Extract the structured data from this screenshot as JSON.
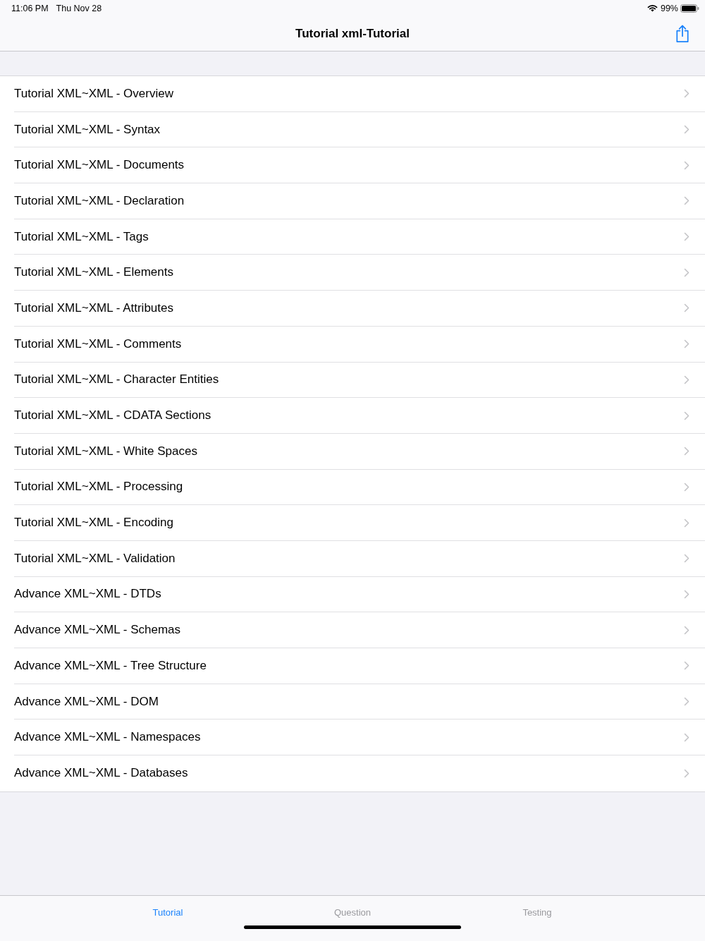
{
  "status_bar": {
    "time": "11:06 PM",
    "date": "Thu Nov 28",
    "battery": "99%"
  },
  "nav_bar": {
    "title": "Tutorial xml-Tutorial"
  },
  "list": {
    "items": [
      {
        "label": "Tutorial XML~XML - Overview"
      },
      {
        "label": "Tutorial XML~XML - Syntax"
      },
      {
        "label": "Tutorial XML~XML - Documents"
      },
      {
        "label": "Tutorial XML~XML - Declaration"
      },
      {
        "label": "Tutorial XML~XML - Tags"
      },
      {
        "label": "Tutorial XML~XML - Elements"
      },
      {
        "label": "Tutorial XML~XML - Attributes"
      },
      {
        "label": "Tutorial XML~XML - Comments"
      },
      {
        "label": "Tutorial XML~XML - Character Entities"
      },
      {
        "label": "Tutorial XML~XML - CDATA Sections"
      },
      {
        "label": "Tutorial XML~XML - White Spaces"
      },
      {
        "label": "Tutorial XML~XML - Processing"
      },
      {
        "label": "Tutorial XML~XML - Encoding"
      },
      {
        "label": "Tutorial XML~XML - Validation"
      },
      {
        "label": "Advance XML~XML - DTDs"
      },
      {
        "label": "Advance XML~XML - Schemas"
      },
      {
        "label": "Advance XML~XML - Tree Structure"
      },
      {
        "label": "Advance XML~XML - DOM"
      },
      {
        "label": "Advance XML~XML - Namespaces"
      },
      {
        "label": "Advance XML~XML - Databases"
      }
    ]
  },
  "tab_bar": {
    "tabs": [
      {
        "label": "Tutorial",
        "selected": true
      },
      {
        "label": "Question",
        "selected": false
      },
      {
        "label": "Testing",
        "selected": false
      }
    ]
  }
}
